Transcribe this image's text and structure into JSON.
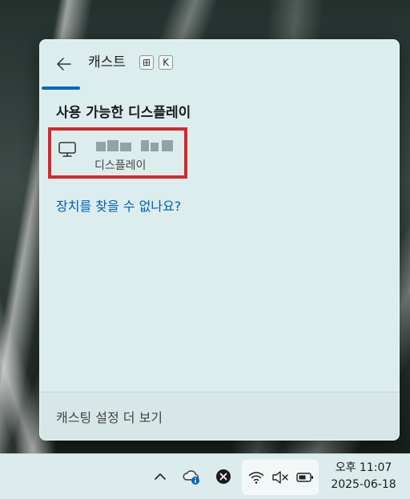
{
  "panel": {
    "title": "캐스트",
    "shortcut_keys": [
      "⊞",
      "K"
    ],
    "section_heading": "사용 가능한 디스플레이",
    "devices": [
      {
        "name": "",
        "subtitle": "디스플레이",
        "icon": "monitor-icon"
      }
    ],
    "help_link": "장치를 찾을 수 없나요?",
    "footer_link": "캐스팅 설정 더 보기"
  },
  "taskbar": {
    "icons": [
      "chevron-up-icon",
      "cloud-info-icon",
      "close-circle-icon",
      "wifi-icon",
      "speaker-muted-icon",
      "battery-icon"
    ],
    "time": "오후 11:07",
    "date": "2025-06-18"
  },
  "colors": {
    "accent": "#0067c0",
    "link": "#005fb8",
    "highlight_border": "#d7262c",
    "panel_bg": "#dcedee"
  }
}
